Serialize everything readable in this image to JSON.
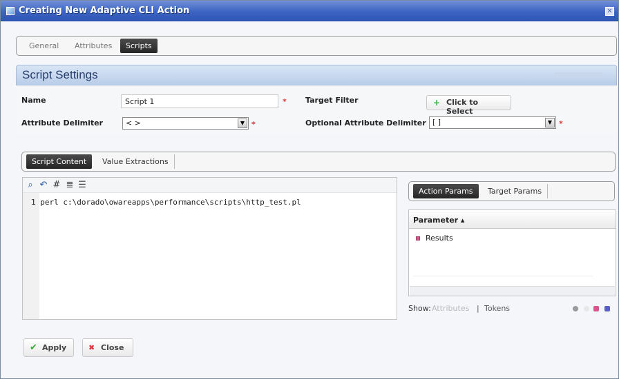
{
  "window": {
    "title": "Creating New Adaptive CLI Action"
  },
  "top_tabs": [
    {
      "label": "General"
    },
    {
      "label": "Attributes"
    },
    {
      "label": "Scripts"
    }
  ],
  "section": {
    "title": "Script Settings"
  },
  "form": {
    "name_label": "Name",
    "name_value": "Script 1",
    "attr_delim_label": "Attribute Delimiter",
    "attr_delim_value": "< >",
    "target_filter_label": "Target Filter",
    "target_filter_button": "Click to Select",
    "opt_attr_delim_label": "Optional Attribute Delimiter",
    "opt_attr_delim_value": "[ ]"
  },
  "content_tabs": [
    {
      "label": "Script Content"
    },
    {
      "label": "Value Extractions"
    }
  ],
  "editor": {
    "line_number": "1",
    "code": "perl c:\\dorado\\owareapps\\performance\\scripts\\http_test.pl"
  },
  "params_tabs": [
    {
      "label": "Action Params"
    },
    {
      "label": "Target Params"
    }
  ],
  "param_grid": {
    "header": "Parameter ▴",
    "rows": [
      {
        "label": "Results"
      }
    ]
  },
  "show": {
    "label": "Show:",
    "attributes": "Attributes",
    "separator": "|",
    "tokens": "Tokens"
  },
  "footer": {
    "apply": "Apply",
    "close": "Close"
  },
  "colors": {
    "titlebar": "#3c63c2",
    "accent_dark": "#262626",
    "required": "#d43a3a",
    "result_dot": "#d2598b"
  }
}
